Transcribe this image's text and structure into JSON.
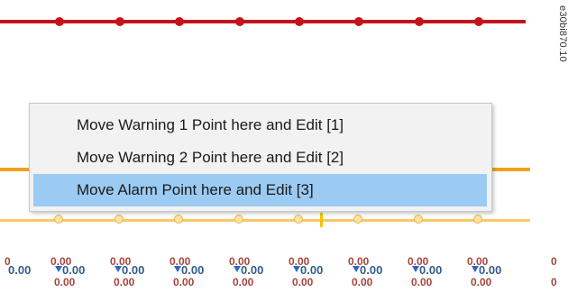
{
  "figure_id": "e30bi870.10",
  "context_menu": {
    "items": [
      {
        "label": "Move Warning 1 Point here and Edit [1]",
        "selected": false
      },
      {
        "label": "Move Warning 2 Point here and Edit [2]",
        "selected": false
      },
      {
        "label": "Move Alarm Point here and Edit [3]",
        "selected": true
      }
    ]
  },
  "point_labels": {
    "first_top": "0",
    "first_value": "0.00",
    "last_top": "0",
    "last_bottom": "0",
    "groups": [
      {
        "top": "0.00",
        "value": "0.00",
        "bottom": "0.00"
      },
      {
        "top": "0.00",
        "value": "0.00",
        "bottom": "0.00"
      },
      {
        "top": "0.00",
        "value": "0.00",
        "bottom": "0.00"
      },
      {
        "top": "0.00",
        "value": "0.00",
        "bottom": "0.00"
      },
      {
        "top": "0.00",
        "value": "0.00",
        "bottom": "0.00"
      },
      {
        "top": "0.00",
        "value": "0.00",
        "bottom": "0.00"
      },
      {
        "top": "0.00",
        "value": "0.00",
        "bottom": "0.00"
      },
      {
        "top": "0.00",
        "value": "0.00",
        "bottom": "0.00"
      }
    ]
  },
  "colors": {
    "alarm_line": "#c4141b",
    "warning_line": "#f0a21e",
    "curve_line": "#f7c96a",
    "menu_highlight": "#9bcaf2"
  }
}
